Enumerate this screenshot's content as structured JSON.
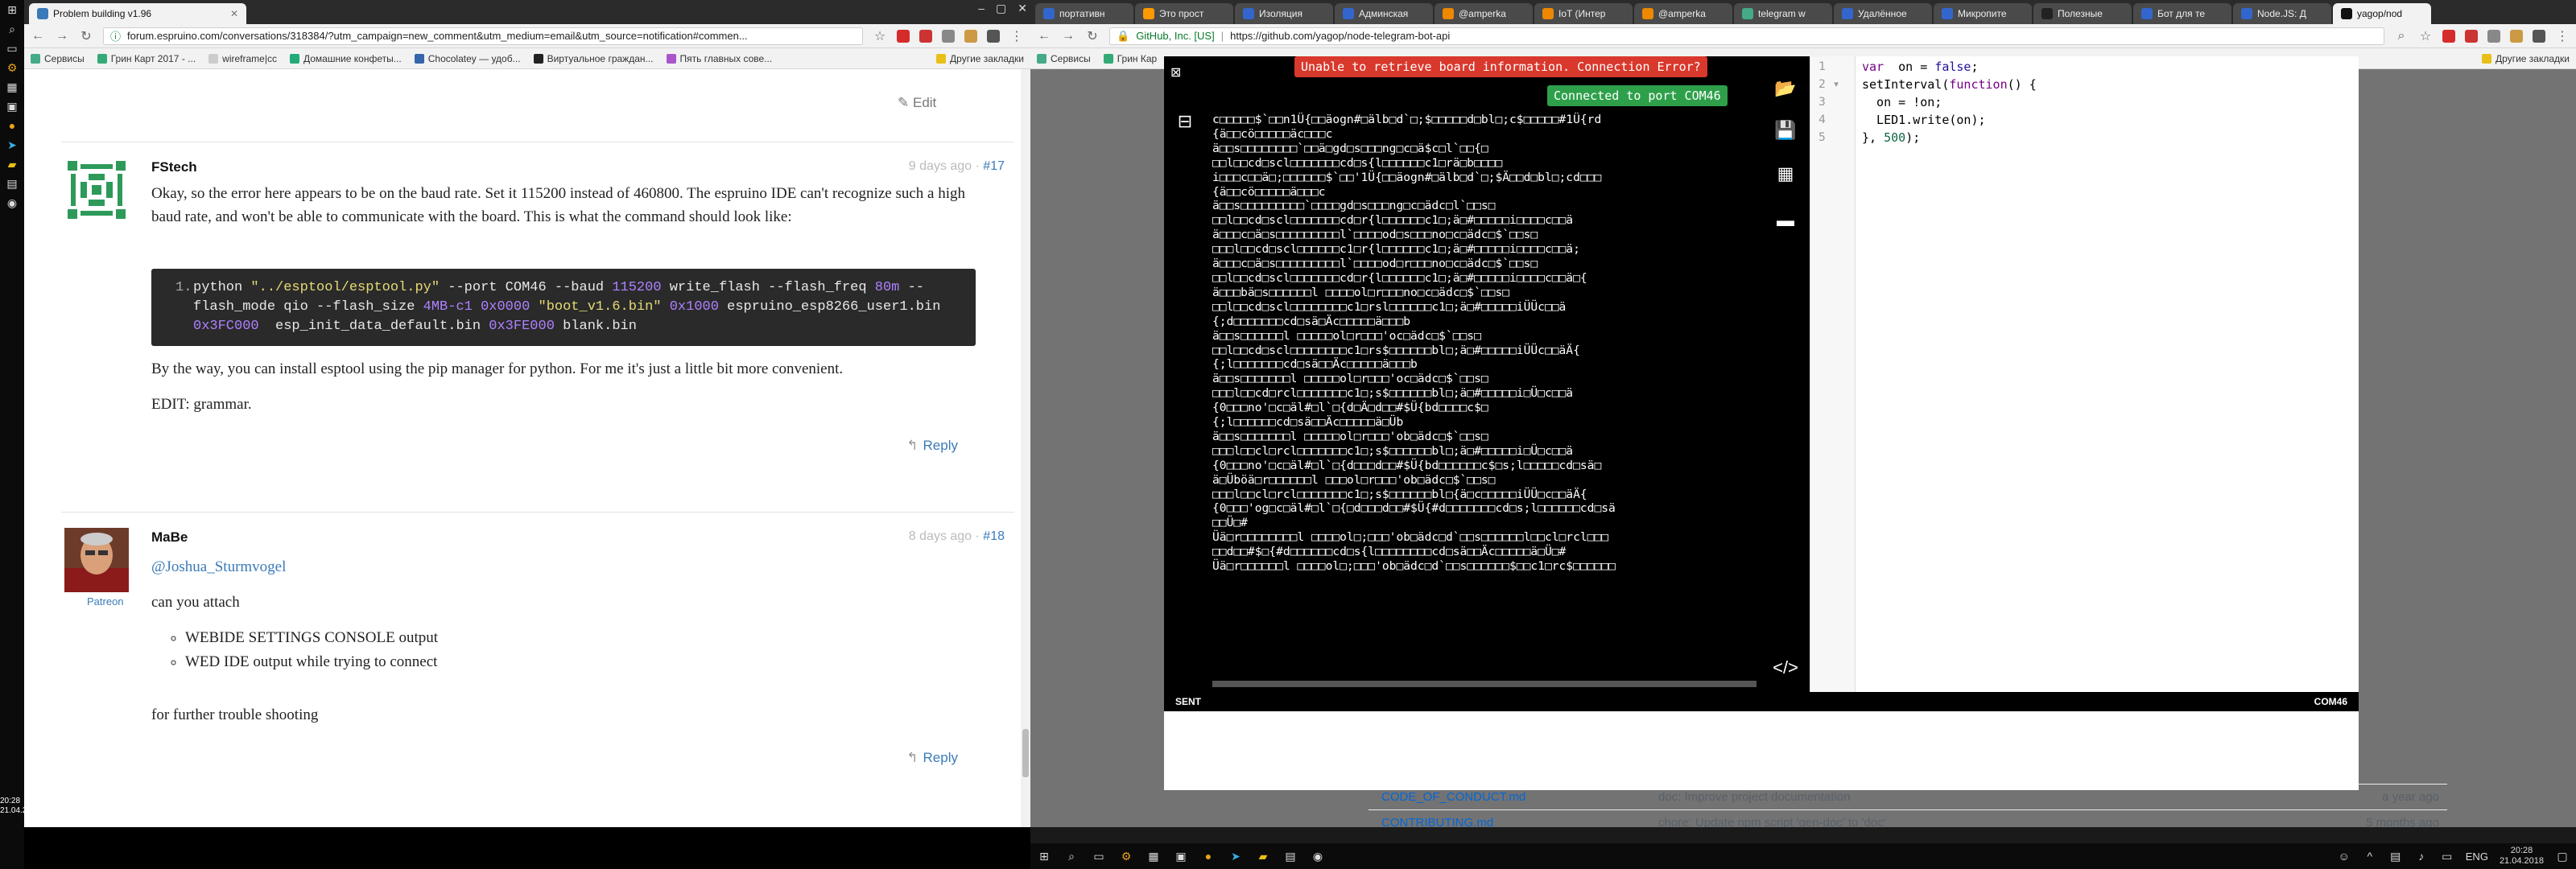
{
  "os": {
    "clock_left_time": "20:28",
    "clock_left_date": "21.04.2018",
    "taskbar_time": "20:28",
    "taskbar_date": "21.04.2018",
    "language": "ENG"
  },
  "browser1": {
    "tab_title": "Problem building v1.96",
    "url": "forum.espruino.com/conversations/318384/?utm_campaign=new_comment&utm_medium=email&utm_source=notification#commen...",
    "bookmarks": [
      "Сервисы",
      "Грин Карт 2017 - ...",
      "wireframe|cc",
      "Домашние конфеты...",
      "Chocolatey — удоб...",
      "Виртуальное граждан...",
      "Пять главных сове...",
      "Другие закладки"
    ],
    "edit_label": "Edit",
    "posts": [
      {
        "user": "FStech",
        "time": "9 days ago",
        "num": "#17",
        "p1": "Okay, so the error here appears to be on the baud rate. Set it 115200 instead of 460800. The espruino IDE can't recognize such a high baud rate, and won't be able to communicate with the board. This is what the command should look like:",
        "code_line_no": "1.",
        "p2": "By the way, you can install esptool using the pip manager for python. For me it's just a little bit more convenient.",
        "p3": "EDIT: grammar.",
        "reply": "Reply"
      },
      {
        "user": "MaBe",
        "time": "8 days ago",
        "num": "#18",
        "badge": "Patreon",
        "mention": "@Joshua_Sturmvogel",
        "p1": "can you attach",
        "bullets": [
          "WEBIDE SETTINGS CONSOLE output",
          "WED IDE output while trying to connect"
        ],
        "p2": "for further trouble shooting",
        "reply": "Reply"
      }
    ]
  },
  "browser2": {
    "tabs": [
      "портативн",
      "Это прост",
      "Изоляция",
      "Админская",
      "@amperka",
      "IoT (Интер",
      "@amperka",
      "telegram w",
      "Удалённое",
      "Микропите",
      "Полезные",
      "Бот для те",
      "Node.JS: Д",
      "yagop/nod"
    ],
    "url_org": "GitHub, Inc. [US]",
    "url": "https://github.com/yagop/node-telegram-bot-api",
    "bookmarks": [
      "Сервисы",
      "Грин Кар",
      "Другие закладки"
    ],
    "files": [
      {
        "name": "CODE_OF_CONDUCT.md",
        "msg": "doc: Improve project documentation",
        "time": "a year ago"
      },
      {
        "name": "CONTRIBUTING.md",
        "msg": "chore: Update npm script 'gen-doc' to 'doc'",
        "time": "5 months ago"
      }
    ]
  },
  "ide": {
    "error_toast": "Unable to retrieve board information. Connection Error?",
    "ok_toast": "Connected to port COM46",
    "status_left": "SENT",
    "status_right": "COM46",
    "terminal_lines": [
      "c□□□□□$`□□n1Ü{□□äogn#□älb□d`□;$□□□□□d□bl□;c$□□□□□#1Ü{rd",
      "{ä□□cö□□□□□äc□□□c",
      "ä□□s□□□□□□□□`□□ä□gd□s□□□ng□c□ä$c□l`□□{□",
      "□□l□□cd□scl□□□□□□□cd□s{l□□□□□□c1□rä□b□□□□",
      "i□□□c□□ä□;□□□□□□$`□□'1Ü{□□äogn#□älb□d`□;$Ä□□d□bl□;cd□□□",
      "{ä□□cö□□□□□ä□□□c",
      "ä□□s□□□□□□□□□`□□□□gd□s□□□ng□c□ädc□l`□□s□",
      "□□l□□cd□scl□□□□□□□cd□r{l□□□□□□c1□;ä□#□□□□□i□□□□c□□ä",
      "ä□□□c□ä□s□□□□□□□□□l`□□□□od□s□□□no□c□ädc□$`□□s□",
      "□□□l□□cd□scl□□□□□□c1□r{l□□□□□□c1□;ä□#□□□□□i□□□□c□□ä;",
      "ä□□□c□ä□s□□□□□□□□□l`□□□□od□r□□□no□c□ädc□$`□□s□",
      "□□l□□cd□scl□□□□□□□cd□r{l□□□□□□c1□;ä□#□□□□□i□□□□c□□ä□{",
      "ä□□□bä□s□□□□□□l □□□□ol□r□□□no□c□ädc□$`□□s□",
      "□□l□□cd□scl□□□□□□□□c1□rsl□□□□□□c1□;ä□#□□□□□iÜÜc□□ä",
      "{;d□□□□□□□cd□sä□Äc□□□□□ä□□□b",
      "ä□□s□□□□□□l □□□□□ol□r□□□'oc□ädc□$`□□s□",
      "□□l□□cd□scl□□□□□□□□c1□rs$□□□□□□bl□;ä□#□□□□□iÜÜc□□äÄ{",
      "{;l□□□□□□□cd□sä□□Äc□□□□□ä□□□b",
      "ä□□s□□□□□□□l □□□□□ol□r□□□'oc□ädc□$`□□s□",
      "□□□l□□cd□rcl□□□□□□□c1□;s$□□□□□□bl□;ä□#□□□□□i□Ü□c□□ä",
      "{0□□□no'□c□äl#□l`□{d□Ä□d□□#$Ü{bd□□□□c$□",
      "{;l□□□□□□cd□sä□□Äc□□□□□ä□Üb",
      "ä□□s□□□□□□□l □□□□□ol□r□□□'ob□ädc□$`□□s□",
      "□□□l□□cl□rcl□□□□□□□c1□;s$□□□□□□bl□;ä□#□□□□□i□Ü□c□□ä",
      "{0□□□no'□c□äl#□l`□{d□□□d□□#$Ü{bd□□□□□□c$□s;l□□□□□cd□sä□",
      "ä□Üböä□r□□□□□□l □□□ol□r□□□'ob□ädc□$`□□s□",
      "□□□l□□cl□rcl□□□□□□□c1□;s$□□□□□□bl□{ä□c□□□□□iÜÜ□c□□äÄ{",
      "{0□□□'og□c□äl#□l`□{□d□□□d□□#$Ü{#d□□□□□□□cd□s;l□□□□□□cd□sä",
      "□□Ü□#",
      "Üä□r□□□□□□□□l □□□□ol□;□□□'ob□ädc□d`□□s□□□□□□l□□cl□rcl□□□",
      "□□d□□#$□{#d□□□□□□cd□s{l□□□□□□□□cd□sä□□Äc□□□□□ä□Ü□#",
      "Üä□r□□□□□□l □□□□ol□;□□□'ob□ädc□d`□□s□□□□□□$□□c1□rc$□□□□□□"
    ],
    "code_lines": [
      "1",
      "2",
      "3",
      "4",
      "5"
    ]
  },
  "colors": {
    "link": "#3a7ab8",
    "toast_error": "#d9382c",
    "toast_ok": "#2ea04a"
  }
}
